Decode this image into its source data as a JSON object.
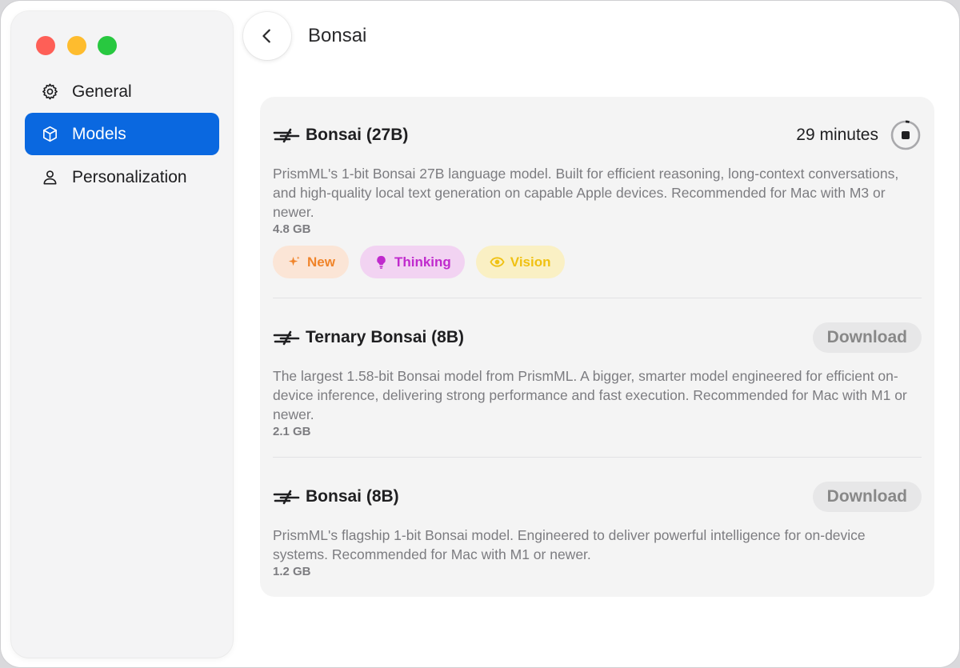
{
  "window": {
    "title": "Bonsai"
  },
  "sidebar": {
    "items": [
      {
        "label": "General",
        "icon": "gear-icon",
        "active": false
      },
      {
        "label": "Models",
        "icon": "cube-icon",
        "active": true
      },
      {
        "label": "Personalization",
        "icon": "person-icon",
        "active": false
      }
    ]
  },
  "header": {
    "title": "Bonsai"
  },
  "models": [
    {
      "name": "Bonsai (27B)",
      "status_text": "29 minutes",
      "description": "PrismML's 1-bit Bonsai 27B language model. Built for efficient reasoning, long-context conversations, and high-quality local text generation on capable Apple devices. Recommended for Mac with M3 or newer.",
      "size": "4.8 GB",
      "tags": [
        {
          "label": "New",
          "icon": "sparkle-icon"
        },
        {
          "label": "Thinking",
          "icon": "lightbulb-icon"
        },
        {
          "label": "Vision",
          "icon": "eye-icon"
        }
      ]
    },
    {
      "name": "Ternary Bonsai (8B)",
      "action_label": "Download",
      "description": "The largest 1.58-bit Bonsai model from PrismML. A bigger, smarter model engineered for efficient on-device inference, delivering strong performance and fast execution. Recommended for Mac with M1 or newer.",
      "size": "2.1 GB"
    },
    {
      "name": "Bonsai (8B)",
      "action_label": "Download",
      "description": "PrismML's flagship 1-bit Bonsai model. Engineered to deliver powerful intelligence for on-device systems. Recommended for Mac with M1 or newer.",
      "size": "1.2 GB"
    }
  ],
  "colors": {
    "accent": "#0a68e0",
    "tag_new": "#f0842a",
    "tag_thinking": "#c02acd",
    "tag_vision": "#f0c112"
  }
}
